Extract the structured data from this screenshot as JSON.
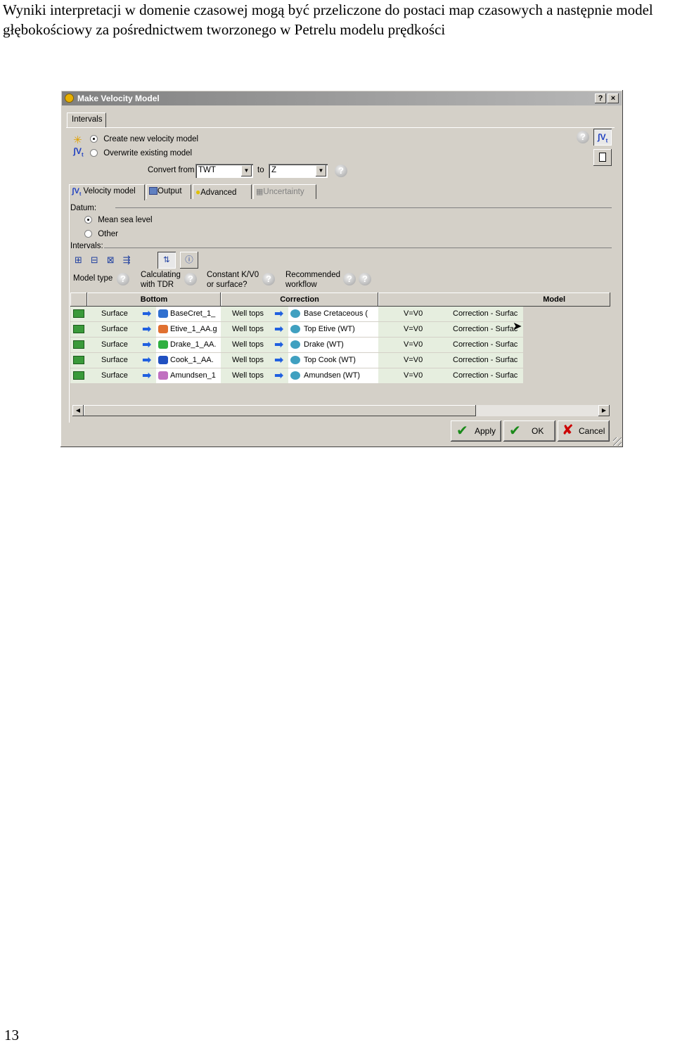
{
  "document": {
    "paragraph": "Wyniki interpretacji w domenie czasowej mogą być przeliczone do postaci map czasowych a następnie model głębokościowy za pośrednictwem tworzonego w Petrelu modelu prędkości",
    "page_number": "13"
  },
  "dialog": {
    "title": "Make Velocity Model",
    "title_buttons": {
      "help": "?",
      "close": "×"
    },
    "tab": "Intervals",
    "mode_options": [
      {
        "label": "Create new velocity model",
        "selected": true
      },
      {
        "label": "Overwrite existing model",
        "selected": false
      }
    ],
    "convert_from_label": "Convert from",
    "convert_from_value": "TWT",
    "to_label": "to",
    "to_value": "Z",
    "subtabs": [
      "Velocity model",
      "Output",
      "Advanced",
      "Uncertainty"
    ],
    "datum_label": "Datum:",
    "datum_options": [
      {
        "label": "Mean sea level",
        "selected": true
      },
      {
        "label": "Other",
        "selected": false
      }
    ],
    "intervals_label": "Intervals:",
    "column_captions": {
      "model_type": "Model type",
      "calc_tdr_1": "Calculating",
      "calc_tdr_2": "with TDR",
      "constant_1": "Constant K/V0",
      "constant_2": "or surface?",
      "recommended_1": "Recommended",
      "recommended_2": "workflow"
    },
    "table_headers": {
      "bottom": "Bottom",
      "correction": "Correction",
      "model": "Model"
    },
    "rows": [
      {
        "type": "Surface",
        "bottom": "BaseCret_1_",
        "correction_type": "Well tops",
        "correction": "Base Cretaceous (",
        "velocity": "V=V0",
        "model": "Correction - Surfac"
      },
      {
        "type": "Surface",
        "bottom": "Etive_1_AA.g",
        "correction_type": "Well tops",
        "correction": "Top Etive (WT)",
        "velocity": "V=V0",
        "model": "Correction - Surfac"
      },
      {
        "type": "Surface",
        "bottom": "Drake_1_AA.",
        "correction_type": "Well tops",
        "correction": "Drake (WT)",
        "velocity": "V=V0",
        "model": "Correction - Surfac"
      },
      {
        "type": "Surface",
        "bottom": "Cook_1_AA.",
        "correction_type": "Well tops",
        "correction": "Top Cook (WT)",
        "velocity": "V=V0",
        "model": "Correction - Surfac"
      },
      {
        "type": "Surface",
        "bottom": "Amundsen_1",
        "correction_type": "Well tops",
        "correction": "Amundsen (WT)",
        "velocity": "V=V0",
        "model": "Correction - Surfac"
      }
    ],
    "buttons": {
      "apply": "Apply",
      "ok": "OK",
      "cancel": "Cancel"
    },
    "icons": [
      "new-model-sparkle-icon",
      "velocity-model-icon",
      "help-icon",
      "add-interval-icon",
      "insert-interval-icon",
      "remove-interval-icon",
      "move-interval-icon",
      "tdr-table-icon",
      "info-icon",
      "notes-icon"
    ]
  }
}
